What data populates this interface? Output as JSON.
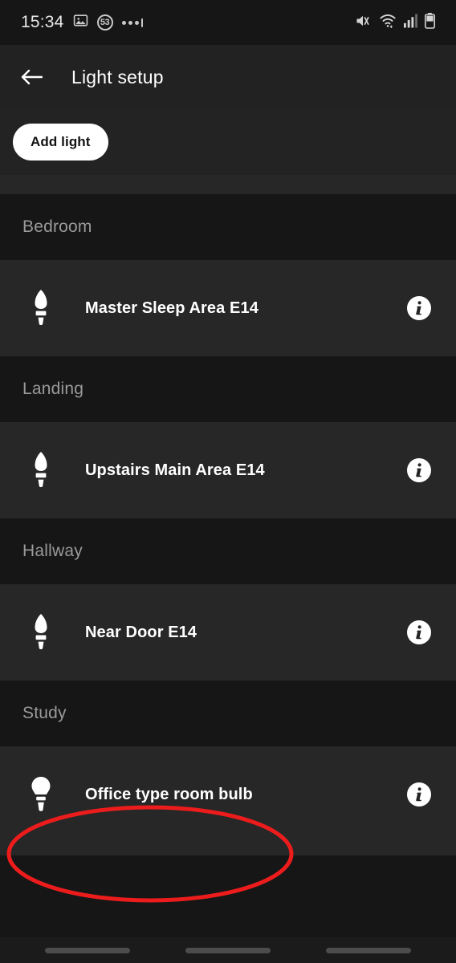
{
  "status_bar": {
    "time": "15:34",
    "notification_badge": "53",
    "icons": [
      "image-icon",
      "notification-count-badge",
      "more-notifications-icon",
      "volume-mute-icon",
      "wifi-icon",
      "cellular-signal-icon",
      "battery-icon"
    ]
  },
  "app_bar": {
    "back_label": "back-arrow-icon",
    "title": "Light setup"
  },
  "toolbar": {
    "add_light_label": "Add light"
  },
  "colors": {
    "row_background": "#272727",
    "section_background": "#161616",
    "app_bar_background": "#222222",
    "accent_white": "#ffffff",
    "section_text": "#9a9a9a",
    "annotation_red": "#ed1c1c"
  },
  "sections": [
    {
      "name": "Bedroom",
      "lights": [
        {
          "name": "Master Sleep Area E14",
          "bulb": "candle-bulb-icon",
          "info": "info-icon",
          "highlighted": false
        }
      ]
    },
    {
      "name": "Landing",
      "lights": [
        {
          "name": "Upstairs Main Area E14",
          "bulb": "candle-bulb-icon",
          "info": "info-icon",
          "highlighted": false
        }
      ]
    },
    {
      "name": "Hallway",
      "lights": [
        {
          "name": "Near Door E14",
          "bulb": "candle-bulb-icon",
          "info": "info-icon",
          "highlighted": false
        }
      ]
    },
    {
      "name": "Study",
      "lights": [
        {
          "name": "Office type room bulb",
          "bulb": "standard-bulb-icon",
          "info": "info-icon",
          "highlighted": true
        }
      ]
    }
  ],
  "annotation": {
    "shape": "ellipse",
    "target": "Office type room bulb"
  },
  "nav_bar": {
    "items": [
      "recents-pill",
      "home-pill",
      "back-pill"
    ]
  }
}
